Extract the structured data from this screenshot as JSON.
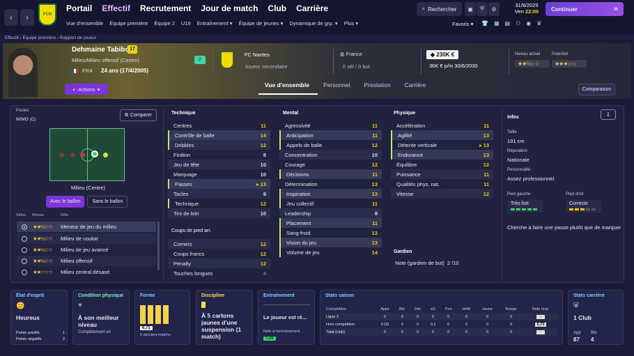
{
  "topbar": {
    "menu": [
      "Portail",
      "Effectif",
      "Recrutement",
      "Jour de match",
      "Club",
      "Carrière"
    ],
    "menu_active_index": 1,
    "submenu": [
      "Vue d'ensemble",
      "Équipe première",
      "Équipe 2",
      "U19",
      "Entraînement",
      "Équipe de jeunes",
      "Dynamique de grp.",
      "Plus"
    ],
    "search_label": "Rechercher",
    "date_top": "31/8/2029",
    "date_day": "Ven",
    "date_time": "22:00",
    "continue_label": "Continuer",
    "favorites_label": "Favoris"
  },
  "breadcrumb": [
    "Effectif",
    "Équipe première",
    "Rapport de joueur"
  ],
  "player": {
    "name": "Dehmaine Tabibou",
    "number": "17",
    "position": "Milieu/Milieu offensif (Centre)",
    "nationality_code": "FRA",
    "age": "24 ans (17/4/2005)",
    "actions_label": "Actions",
    "squad_number_badge": "2",
    "club": "FC Nantes",
    "squad_status": "Joueur secondaire",
    "nation": "France",
    "caps": "0 sél / 0 but",
    "value": "230K €",
    "wage_contract": "36K € p/m 30/6/2030",
    "current_level_label": "Niveau actuel",
    "potential_label": "Potentiel",
    "current_stars": "★★½☆☆",
    "potential_stars": "★★★☆☆"
  },
  "tabs": [
    "Vue d'ensemble",
    "Personnel",
    "Prestation",
    "Carrière"
  ],
  "comparison_label": "Comparaison",
  "positions": {
    "title": "Postes",
    "value": "M/MO (C)",
    "compare_label": "Comparer",
    "role_label": "Milieu (Centre)",
    "with_ball": "Avec le ballon",
    "without_ball": "Sans le ballon",
    "headers": [
      "Sélec.",
      "Niveau",
      "Rôle"
    ],
    "roles": [
      {
        "stars": "★★½☆☆",
        "name": "Meneur de jeu du milieu",
        "selected": true
      },
      {
        "stars": "★★½☆☆",
        "name": "Milieu de couloir",
        "selected": false
      },
      {
        "stars": "★★½☆☆",
        "name": "Milieu de jeu avancé",
        "selected": false
      },
      {
        "stars": "★★½☆☆",
        "name": "Milieu offensif",
        "selected": false
      },
      {
        "stars": "★★☆☆☆",
        "name": "Milieu central désaxé",
        "selected": false
      }
    ]
  },
  "attributes": {
    "technique_title": "Technique",
    "technique": [
      [
        "Centres",
        "11"
      ],
      [
        "Contrôle de balle",
        "14"
      ],
      [
        "Dribbles",
        "12"
      ],
      [
        "Finition",
        "8"
      ],
      [
        "Jeu de tête",
        "10"
      ],
      [
        "Marquage",
        "10"
      ],
      [
        "Passes",
        "13"
      ],
      [
        "Tacles",
        "9"
      ],
      [
        "Technique",
        "12"
      ],
      [
        "Tirs de loin",
        "10"
      ]
    ],
    "setpieces_title": "Coups de pied arr.",
    "setpieces": [
      [
        "Corners",
        "12"
      ],
      [
        "Coups francs",
        "12"
      ],
      [
        "Penalty",
        "12"
      ],
      [
        "Touches longues",
        "4"
      ]
    ],
    "mental_title": "Mental",
    "mental": [
      [
        "Agressivité",
        "11"
      ],
      [
        "Anticipation",
        "11"
      ],
      [
        "Appels de balle",
        "12"
      ],
      [
        "Concentration",
        "10"
      ],
      [
        "Courage",
        "12"
      ],
      [
        "Décisions",
        "11"
      ],
      [
        "Détermination",
        "13"
      ],
      [
        "Inspiration",
        "13"
      ],
      [
        "Jeu collectif",
        "11"
      ],
      [
        "Leadership",
        "8"
      ],
      [
        "Placement",
        "11"
      ],
      [
        "Sang-froid",
        "13"
      ],
      [
        "Vision du jeu",
        "13"
      ],
      [
        "Volume de jeu",
        "14"
      ]
    ],
    "physical_title": "Physique",
    "physical": [
      [
        "Accélération",
        "11"
      ],
      [
        "Agilité",
        "13"
      ],
      [
        "Détente verticale",
        "13"
      ],
      [
        "Endurance",
        "13"
      ],
      [
        "Équilibre",
        "12"
      ],
      [
        "Puissance",
        "11"
      ],
      [
        "Qualités phys. nat.",
        "11"
      ],
      [
        "Vitesse",
        "12"
      ]
    ],
    "goalkeeper_title": "Gardien",
    "goalkeeper_label": "Note (gardien de but)",
    "goalkeeper_value": "2 /10"
  },
  "infos": {
    "title": "Infos",
    "height_label": "Taille",
    "height": "181 cm",
    "reputation_label": "Réputation",
    "reputation": "Nationale",
    "personality_label": "Personnalité",
    "personality": "Assez professionnel",
    "left_foot_label": "Pied gauche",
    "left_foot": "Très fort",
    "right_foot_label": "Pied droit",
    "right_foot": "Correcte",
    "trait": "Cherche à faire une passe plutôt que de marquer"
  },
  "cards": {
    "mood_title": "État d'esprit",
    "mood": "Heureux",
    "positive_label": "Points positifs",
    "positive": "1",
    "negative_label": "Points négatifs",
    "negative": "2",
    "condition_title": "Condition physique",
    "condition": "À son meilleur niveau",
    "condition_sub": "Complètement en",
    "form_title": "Forme",
    "form_value": "6,71",
    "form_sub": "5 derniers matchs",
    "discipline_title": "Discipline",
    "discipline": "À 5 cartons jaunes d'une suspension (1 match)",
    "training_title": "Entraînement",
    "training": "Le joueur est ré...",
    "training_sub": "Note à l'entraînement",
    "training_value": "7,20",
    "season_title": "Stats saison",
    "season_headers": [
      "Compétition",
      "Apps",
      "Bts",
      "Déc",
      "xG",
      "Pen",
      "HdM",
      "Jaune",
      "Rouge",
      "Note moy."
    ],
    "season_rows": [
      [
        "Ligue 2",
        "0",
        "0",
        "0",
        "0",
        "0",
        "0",
        "0",
        "0",
        "-"
      ],
      [
        "Hors compétition",
        "0 (3)",
        "0",
        "0",
        "0,1",
        "0",
        "0",
        "0",
        "0",
        "6,73"
      ],
      [
        "Total (club)",
        "0",
        "0",
        "0",
        "0",
        "0",
        "0",
        "0",
        "0",
        "-"
      ]
    ],
    "career_title": "Stats carrière",
    "career_clubs": "1 Club",
    "app_label": "App",
    "app": "87",
    "bts_label": "Bts",
    "bts": "4"
  }
}
